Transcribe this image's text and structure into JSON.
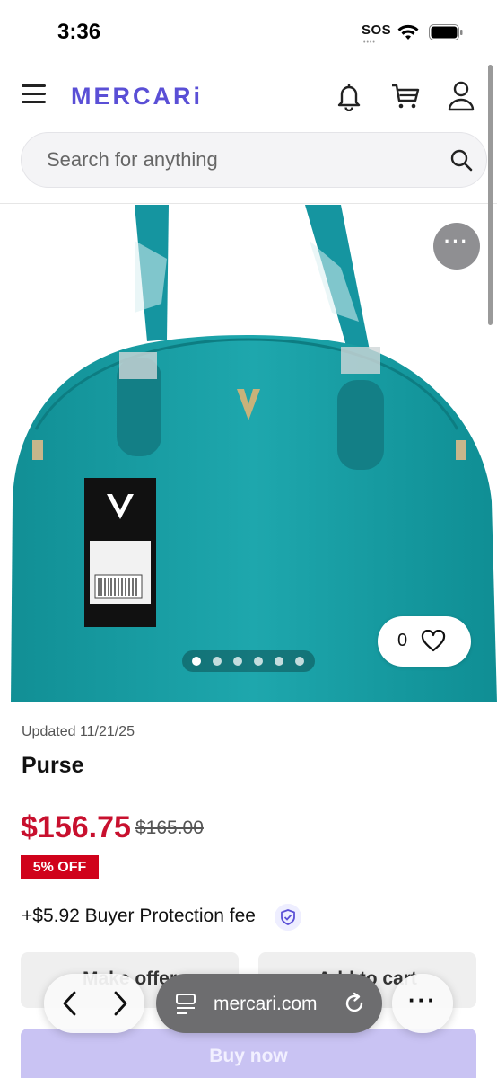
{
  "status_bar": {
    "time": "3:36",
    "carrier": "SOS",
    "carrier_dots": "••••"
  },
  "header": {
    "logo": "MERCARi"
  },
  "search": {
    "placeholder": "Search for anything"
  },
  "product": {
    "updated": "Updated 11/21/25",
    "title": "Purse",
    "price": "$156.75",
    "original_price": "$165.00",
    "discount": "5% OFF",
    "buyer_fee": "+$5.92 Buyer Protection fee",
    "like_count": "0",
    "image_count": 6,
    "active_image_index": 0,
    "more_label": "···"
  },
  "actions": {
    "make_offer": "Make offer",
    "add_to_cart": "Add to cart",
    "buy_now": "Buy now"
  },
  "browser": {
    "url": "mercari.com",
    "more_label": "···"
  },
  "colors": {
    "brand": "#5a4fd6",
    "price": "#c8102e",
    "discount_badge": "#d0021b",
    "bag": "#1a9ea3",
    "buy_button": "#c9c3f3"
  }
}
